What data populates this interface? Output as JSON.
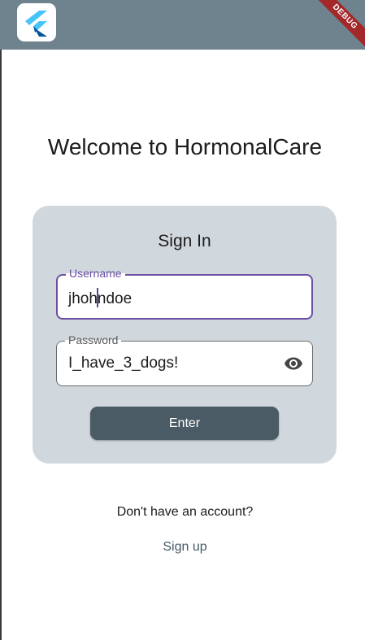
{
  "app": {
    "debug_banner": "DEBUG",
    "logo_icon": "flutter-logo-icon"
  },
  "page": {
    "welcome_title": "Welcome to HormonalCare"
  },
  "signin": {
    "title": "Sign In",
    "username": {
      "label": "Username",
      "value_before_caret": "jhoh",
      "value_after_caret": "ndoe"
    },
    "password": {
      "label": "Password",
      "value": "I_have_3_dogs!",
      "toggle_icon": "eye-icon"
    },
    "enter_label": "Enter"
  },
  "footer": {
    "no_account_text": "Don't have an account?",
    "signup_label": "Sign up"
  },
  "colors": {
    "appbar": "#6f838e",
    "card": "#d1d8dd",
    "focus_accent": "#6a4fa3",
    "button": "#4b5b66",
    "link": "#455a66",
    "debug_banner": "#a3282a"
  }
}
